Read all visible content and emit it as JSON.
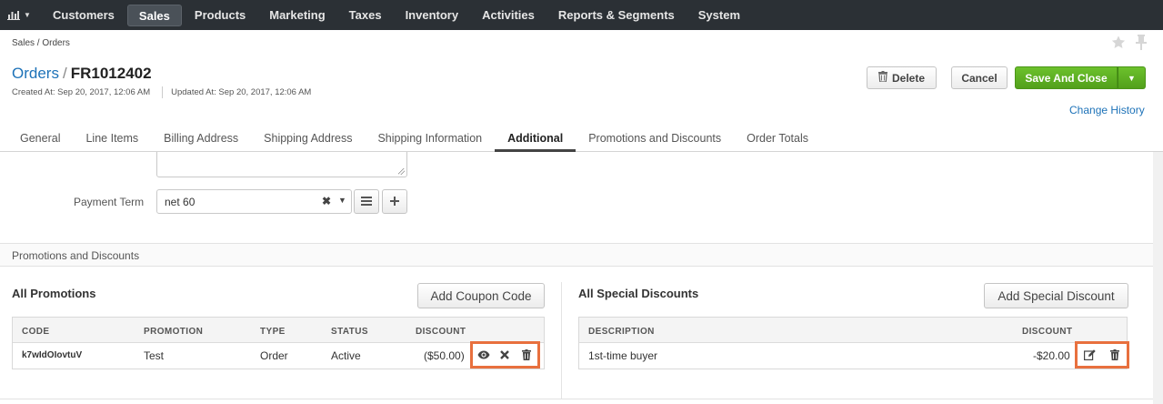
{
  "topnav": {
    "menu_icon": "bar-chart-icon",
    "items": [
      "Customers",
      "Sales",
      "Products",
      "Marketing",
      "Taxes",
      "Inventory",
      "Activities",
      "Reports & Segments",
      "System"
    ],
    "active": "Sales"
  },
  "breadcrumb": "Sales / Orders",
  "header": {
    "crumb": "Orders",
    "separator": "/",
    "order_number": "FR1012402",
    "created": "Created At: Sep 20, 2017, 12:06 AM",
    "updated": "Updated At: Sep 20, 2017, 12:06 AM"
  },
  "actions": {
    "delete_label": "Delete",
    "cancel_label": "Cancel",
    "save_label": "Save And Close",
    "change_history": "Change History"
  },
  "tabs": [
    "General",
    "Line Items",
    "Billing Address",
    "Shipping Address",
    "Shipping Information",
    "Additional",
    "Promotions and Discounts",
    "Order Totals"
  ],
  "active_tab": "Additional",
  "payment_term": {
    "label": "Payment Term",
    "value": "net 60"
  },
  "promotions_section": {
    "title": "Promotions and Discounts",
    "all_promotions": {
      "title": "All Promotions",
      "add_button": "Add Coupon Code",
      "columns": [
        "CODE",
        "PROMOTION",
        "TYPE",
        "STATUS",
        "DISCOUNT"
      ],
      "rows": [
        {
          "code": "k7wIdOIovtuV",
          "promotion": "Test",
          "type": "Order",
          "status": "Active",
          "discount": "($50.00)"
        }
      ]
    },
    "special_discounts": {
      "title": "All Special Discounts",
      "add_button": "Add Special Discount",
      "columns": [
        "DESCRIPTION",
        "DISCOUNT"
      ],
      "rows": [
        {
          "description": "1st-time buyer",
          "discount": "-$20.00"
        }
      ]
    }
  },
  "colors": {
    "nav_bg": "#2b3035",
    "link": "#1d72b8",
    "save_green": "#5cb122",
    "highlight": "#e8703e"
  }
}
